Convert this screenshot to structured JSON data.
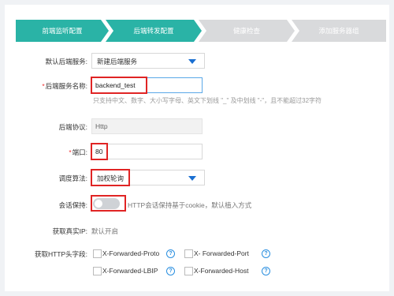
{
  "steps": [
    {
      "label": "前端监听配置",
      "state": "done"
    },
    {
      "label": "后端转发配置",
      "state": "done"
    },
    {
      "label": "健康检查",
      "state": "todo"
    },
    {
      "label": "添加服务器组",
      "state": "todo"
    }
  ],
  "form": {
    "default_backend": {
      "label": "默认后端服务:",
      "value": "新建后端服务"
    },
    "backend_name": {
      "label": "后端服务名称:",
      "required_mark": "*",
      "value": "backend_test",
      "hint": "只支持中文、数字、大小写字母、英文下划线 \"_\" 及中划线 \"-\"，且不能超过32字符"
    },
    "protocol": {
      "label": "后端协议:",
      "value": "Http"
    },
    "port": {
      "label": "端口:",
      "required_mark": "*",
      "value": "80"
    },
    "algorithm": {
      "label": "调度算法:",
      "value": "加权轮询"
    },
    "session": {
      "label": "会话保持:",
      "text": "HTTP会话保持基于cookie，默认植入方式",
      "enabled": false
    },
    "real_ip": {
      "label": "获取真实IP:",
      "value": "默认开启"
    },
    "headers": {
      "label": "获取HTTP头字段:",
      "options": [
        {
          "label": "X-Forwarded-Proto",
          "checked": false
        },
        {
          "label": "X- Forwarded-Port",
          "checked": false
        },
        {
          "label": "X-Forwarded-LBIP",
          "checked": false
        },
        {
          "label": "X-Forwarded-Host",
          "checked": false
        }
      ],
      "help_glyph": "?"
    }
  },
  "colors": {
    "step_done": "#2ab3a6",
    "step_todo": "#d9dadc",
    "highlight": "#e02424",
    "caret": "#1a6fd1"
  }
}
